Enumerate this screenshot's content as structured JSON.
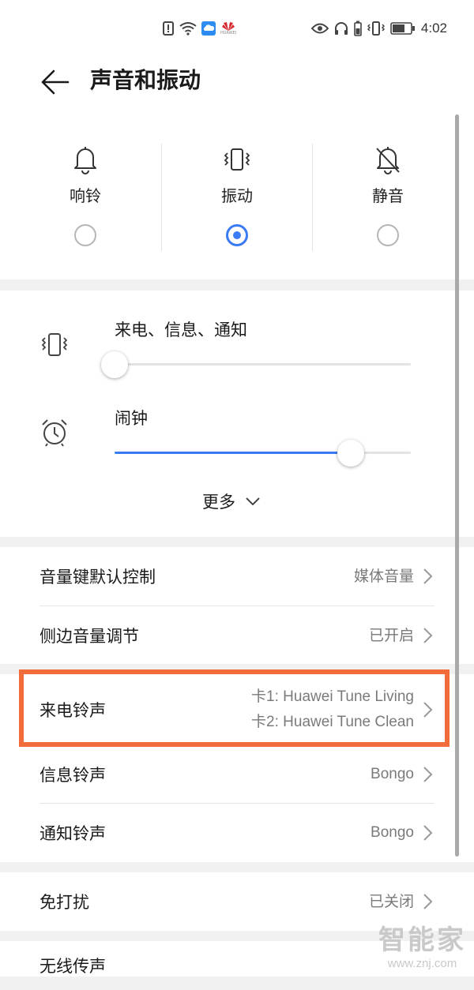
{
  "status_bar": {
    "brand": "HUAWEI",
    "time": "4:02"
  },
  "header": {
    "title": "声音和振动"
  },
  "modes": [
    {
      "label": "响铃",
      "icon": "bell-icon",
      "selected": false
    },
    {
      "label": "振动",
      "icon": "vibrate-icon",
      "selected": true
    },
    {
      "label": "静音",
      "icon": "bell-off-icon",
      "selected": false
    }
  ],
  "volume": {
    "calls_label": "来电、信息、通知",
    "calls_level": 0,
    "alarm_label": "闹钟",
    "alarm_level": 0.8,
    "more_label": "更多"
  },
  "settings": {
    "volume_key": {
      "label": "音量键默认控制",
      "value": "媒体音量"
    },
    "side_volume": {
      "label": "侧边音量调节",
      "value": "已开启"
    },
    "ringtone": {
      "label": "来电铃声",
      "value_sim1": "卡1: Huawei Tune Living",
      "value_sim2": "卡2: Huawei Tune Clean"
    },
    "message_tone": {
      "label": "信息铃声",
      "value": "Bongo"
    },
    "notification_tone": {
      "label": "通知铃声",
      "value": "Bongo"
    },
    "dnd": {
      "label": "免打扰",
      "value": "已关闭"
    },
    "wireless": {
      "label": "无线传声"
    }
  },
  "watermark": {
    "text": "智能家",
    "url": "www.znj.com"
  },
  "colors": {
    "accent": "#3a7bf5",
    "highlight": "#f26b3a"
  }
}
